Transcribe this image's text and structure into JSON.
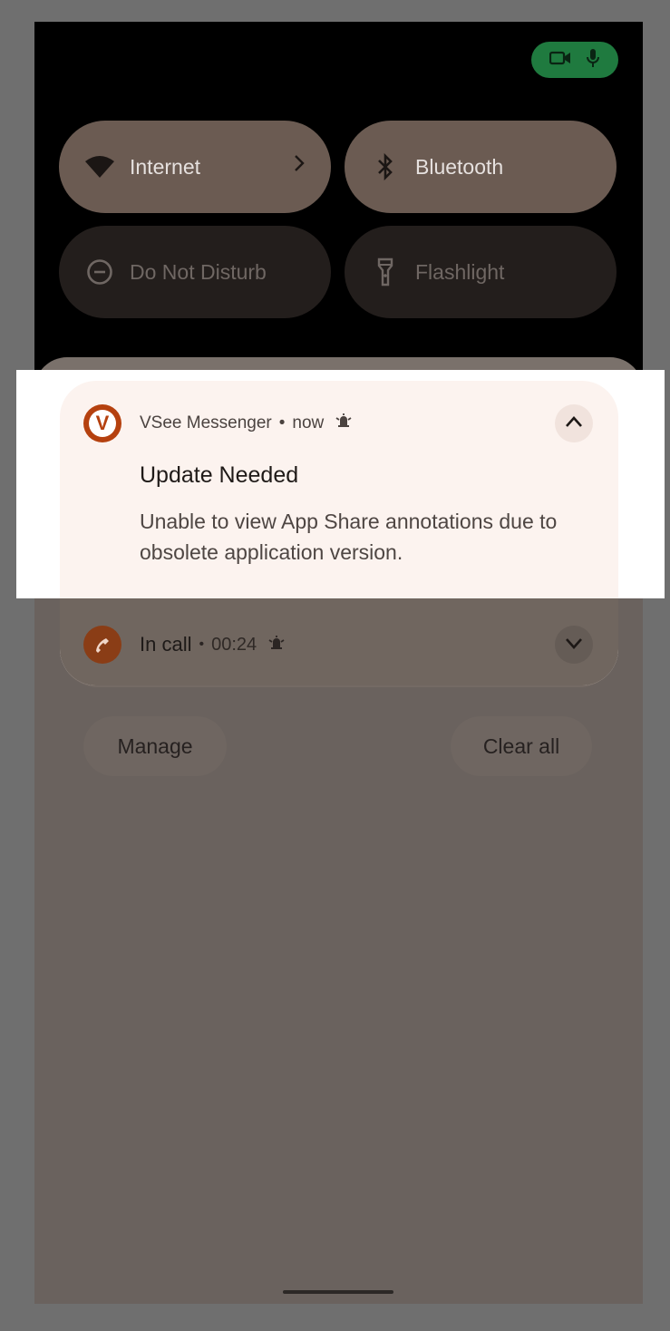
{
  "quick_settings": {
    "tiles": [
      {
        "label": "Internet",
        "icon": "wifi-icon",
        "state": "on"
      },
      {
        "label": "Bluetooth",
        "icon": "bluetooth-icon",
        "state": "on"
      },
      {
        "label": "Do Not Disturb",
        "icon": "dnd-icon",
        "state": "off"
      },
      {
        "label": "Flashlight",
        "icon": "flashlight-icon",
        "state": "off"
      }
    ],
    "privacy_indicator": {
      "icons": [
        "camera-icon",
        "microphone-icon"
      ],
      "color": "#1f7a3f"
    }
  },
  "notifications": {
    "vsee": {
      "app_name": "VSee Messenger",
      "separator": "•",
      "time": "now",
      "title": "Update Needed",
      "body": "Unable to view App Share annotations due to obsolete application version.",
      "icon_letter": "V"
    },
    "call": {
      "label": "In call",
      "separator": "•",
      "duration": "00:24"
    }
  },
  "actions": {
    "manage_label": "Manage",
    "clear_all_label": "Clear all"
  },
  "colors": {
    "accent": "#b5410f",
    "notification_bg": "#fcf3ef"
  }
}
